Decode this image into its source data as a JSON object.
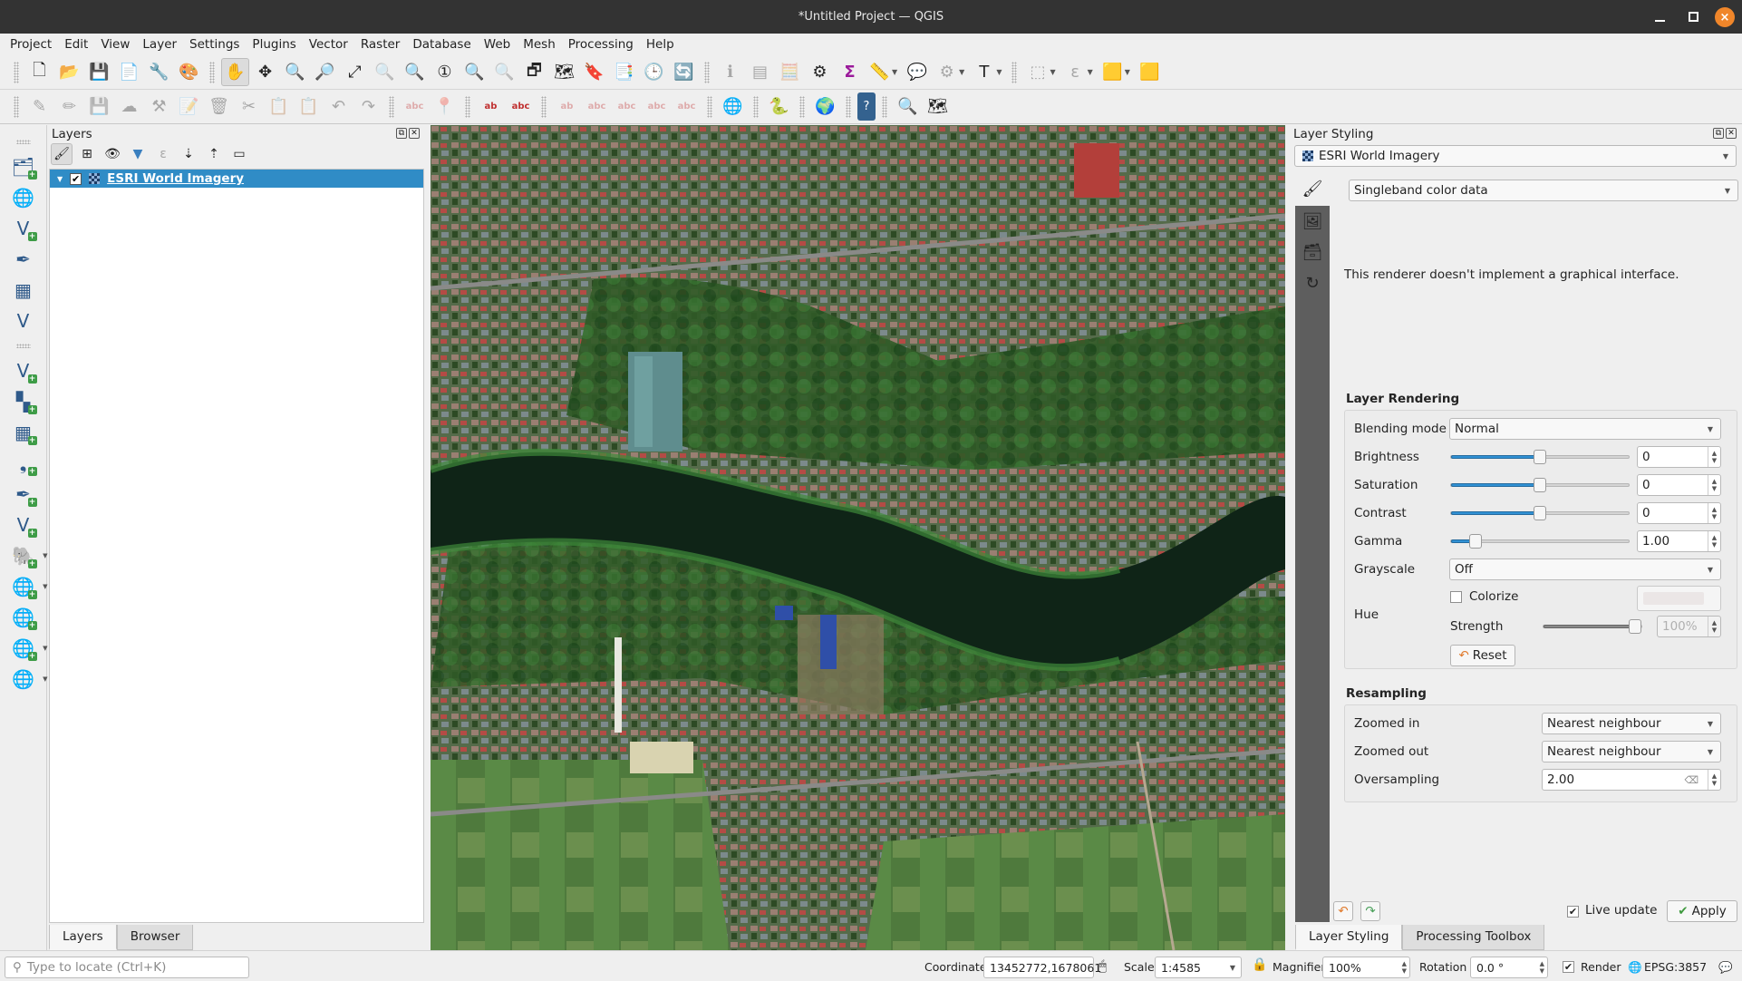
{
  "window": {
    "title": "*Untitled Project — QGIS",
    "controls": {
      "minimize": "minimize",
      "maximize": "maximize",
      "close": "×"
    }
  },
  "menubar": [
    "Project",
    "Edit",
    "View",
    "Layer",
    "Settings",
    "Plugins",
    "Vector",
    "Raster",
    "Database",
    "Web",
    "Mesh",
    "Processing",
    "Help"
  ],
  "toolbar1": [
    {
      "name": "new-project-icon",
      "glyph": "🗋"
    },
    {
      "name": "open-project-icon",
      "glyph": "📂"
    },
    {
      "name": "save-project-icon",
      "glyph": "💾"
    },
    {
      "name": "new-print-layout-icon",
      "glyph": "📄"
    },
    {
      "name": "layout-manager-icon",
      "glyph": "🔧"
    },
    {
      "name": "style-manager-icon",
      "glyph": "🎨"
    },
    {
      "name": "pan-map-icon",
      "glyph": "✋",
      "active": true
    },
    {
      "name": "pan-to-selection-icon",
      "glyph": "✥"
    },
    {
      "name": "zoom-in-icon",
      "glyph": "🔍"
    },
    {
      "name": "zoom-out-icon",
      "glyph": "🔎"
    },
    {
      "name": "zoom-full-icon",
      "glyph": "⤢"
    },
    {
      "name": "zoom-to-selection-icon",
      "glyph": "🔍",
      "dim": true
    },
    {
      "name": "zoom-to-layer-icon",
      "glyph": "🔍"
    },
    {
      "name": "zoom-native-resolution-icon",
      "glyph": "①"
    },
    {
      "name": "zoom-last-icon",
      "glyph": "🔍"
    },
    {
      "name": "zoom-next-icon",
      "glyph": "🔍",
      "dim": true
    },
    {
      "name": "new-map-view-icon",
      "glyph": "🗗"
    },
    {
      "name": "new-3d-map-view-icon",
      "glyph": "🗺"
    },
    {
      "name": "new-bookmark-icon",
      "glyph": "🔖"
    },
    {
      "name": "show-bookmarks-icon",
      "glyph": "📑"
    },
    {
      "name": "temporal-controller-icon",
      "glyph": "🕒"
    },
    {
      "name": "refresh-icon",
      "glyph": "🔄"
    },
    {
      "name": "identify-features-icon",
      "glyph": "ℹ",
      "dim": true
    },
    {
      "name": "attribute-table-icon",
      "glyph": "▤",
      "dim": true
    },
    {
      "name": "field-calculator-icon",
      "glyph": "🧮",
      "dim": true
    },
    {
      "name": "processing-toolbox-icon",
      "glyph": "⚙"
    },
    {
      "name": "statistical-summary-icon",
      "glyph": "Σ"
    },
    {
      "name": "measure-line-icon",
      "glyph": "📏",
      "dropdown": true
    },
    {
      "name": "map-tips-icon",
      "glyph": "💬"
    },
    {
      "name": "actions-icon",
      "glyph": "⚙",
      "dim": true,
      "dropdown": true
    },
    {
      "name": "text-annotation-icon",
      "glyph": "T",
      "dropdown": true
    },
    {
      "name": "select-features-icon",
      "glyph": "⬚",
      "dim": true,
      "dropdown": true
    },
    {
      "name": "select-by-expression-icon",
      "glyph": "ε",
      "dim": true,
      "dropdown": true
    },
    {
      "name": "deselect-all-icon",
      "glyph": "🟨",
      "dropdown": true
    },
    {
      "name": "select-by-location-icon",
      "glyph": "🟨"
    }
  ],
  "toolbar2": [
    {
      "name": "current-edits-icon",
      "glyph": "✎",
      "dim": true
    },
    {
      "name": "toggle-editing-icon",
      "glyph": "✏",
      "dim": true
    },
    {
      "name": "save-edits-icon",
      "glyph": "💾",
      "dim": true
    },
    {
      "name": "digitize-icon",
      "glyph": "☁",
      "dim": true
    },
    {
      "name": "vertex-tool-icon",
      "glyph": "⚒",
      "dim": true
    },
    {
      "name": "modify-attributes-icon",
      "glyph": "📝",
      "dim": true
    },
    {
      "name": "delete-selected-icon",
      "glyph": "🗑",
      "dim": true
    },
    {
      "name": "cut-features-icon",
      "glyph": "✂",
      "dim": true
    },
    {
      "name": "copy-features-icon",
      "glyph": "📋",
      "dim": true
    },
    {
      "name": "paste-features-icon",
      "glyph": "📋",
      "dim": true
    },
    {
      "name": "undo-icon",
      "glyph": "↶",
      "dim": true
    },
    {
      "name": "redo-icon",
      "glyph": "↷",
      "dim": true
    },
    {
      "name": "label-toolbar-icon",
      "glyph": "abc",
      "dim": true
    },
    {
      "name": "label-pin-icon",
      "glyph": "📍",
      "dim": true
    },
    {
      "name": "layer-labeling-options-icon",
      "glyph": "ab"
    },
    {
      "name": "layer-diagram-options-icon",
      "glyph": "abc"
    },
    {
      "name": "highlight-pinned-labels-icon",
      "glyph": "ab",
      "dim": true
    },
    {
      "name": "show-hide-labels-icon",
      "glyph": "abc",
      "dim": true
    },
    {
      "name": "move-label-icon",
      "glyph": "abc",
      "dim": true
    },
    {
      "name": "rotate-label-icon",
      "glyph": "abc",
      "dim": true
    },
    {
      "name": "change-label-icon",
      "glyph": "abc",
      "dim": true
    },
    {
      "name": "metasearch-icon",
      "glyph": "🌐"
    },
    {
      "name": "python-console-icon",
      "glyph": "🐍"
    },
    {
      "name": "geometry-checker-icon",
      "glyph": "🌍"
    },
    {
      "name": "help-icon",
      "glyph": "?"
    },
    {
      "name": "quickmapservices-search-icon",
      "glyph": "🔍"
    },
    {
      "name": "plugin-icon",
      "glyph": "🗺"
    }
  ],
  "left_toolbar": [
    {
      "name": "data-source-manager-icon",
      "glyph": "🗂",
      "plus": true
    },
    {
      "name": "new-geopackage-layer-icon",
      "glyph": "🌐",
      "plus": false
    },
    {
      "name": "new-shapefile-layer-icon",
      "glyph": "V",
      "plus": true
    },
    {
      "name": "new-temporary-scratch-layer-icon",
      "glyph": "✒",
      "plus": false
    },
    {
      "name": "new-virtual-layer-icon",
      "glyph": "▦",
      "plus": false
    },
    {
      "name": "new-spatialite-layer-icon",
      "glyph": "V",
      "plus": false
    },
    {
      "name": "add-vector-layer-icon",
      "glyph": "V",
      "plus": true
    },
    {
      "name": "add-raster-layer-icon",
      "glyph": "▚",
      "plus": true
    },
    {
      "name": "add-mesh-layer-icon",
      "glyph": "▦",
      "plus": true
    },
    {
      "name": "add-delimited-text-layer-icon",
      "glyph": "❟",
      "plus": true
    },
    {
      "name": "add-spatialite-layer-icon",
      "glyph": "✒",
      "plus": true
    },
    {
      "name": "add-virtual-layer-icon",
      "glyph": "V",
      "plus": true
    },
    {
      "name": "add-postgis-layer-icon",
      "glyph": "🐘",
      "plus": true,
      "dropdown": true
    },
    {
      "name": "add-wms-layer-icon",
      "glyph": "🌐",
      "plus": true,
      "dropdown": true
    },
    {
      "name": "add-xyz-layer-icon",
      "glyph": "🌐",
      "plus": true
    },
    {
      "name": "add-wfs-layer-icon",
      "glyph": "🌐",
      "plus": true,
      "dropdown": true
    },
    {
      "name": "add-arcgis-layer-icon",
      "glyph": "🌐",
      "plus": false,
      "dropdown": true
    }
  ],
  "layers_panel": {
    "title": "Layers",
    "tools": [
      "open-styling-panel-icon",
      "add-group-icon",
      "manage-visibility-icon",
      "filter-legend-icon",
      "filter-by-expression-icon",
      "expand-all-icon",
      "collapse-all-icon",
      "remove-layer-icon"
    ],
    "layers": [
      {
        "name": "ESRI World Imagery",
        "checked": true,
        "selected": true
      }
    ],
    "tabs": [
      "Layers",
      "Browser"
    ],
    "active_tab": "Layers"
  },
  "styling_panel": {
    "title": "Layer Styling",
    "layer": "ESRI World Imagery",
    "renderer": "Singleband color data",
    "info": "This renderer doesn't implement a graphical interface.",
    "layer_rendering": {
      "title": "Layer Rendering",
      "blending_mode_label": "Blending mode",
      "blending_mode": "Normal",
      "brightness_label": "Brightness",
      "brightness": "0",
      "brightness_slider": 0.5,
      "saturation_label": "Saturation",
      "saturation": "0",
      "saturation_slider": 0.5,
      "contrast_label": "Contrast",
      "contrast": "0",
      "contrast_slider": 0.5,
      "gamma_label": "Gamma",
      "gamma": "1.00",
      "gamma_slider": 0.11,
      "grayscale_label": "Grayscale",
      "grayscale": "Off",
      "hue_label": "Hue",
      "colorize_label": "Colorize",
      "colorize": false,
      "strength_label": "Strength",
      "strength": "100%",
      "strength_slider": 1.0,
      "reset_label": "Reset"
    },
    "resampling": {
      "title": "Resampling",
      "zoomed_in_label": "Zoomed in",
      "zoomed_in": "Nearest neighbour",
      "zoomed_out_label": "Zoomed out",
      "zoomed_out": "Nearest neighbour",
      "oversampling_label": "Oversampling",
      "oversampling": "2.00"
    },
    "live_update_label": "Live update",
    "live_update": true,
    "apply_label": "Apply",
    "tabs": [
      "Layer Styling",
      "Processing Toolbox"
    ],
    "active_tab": "Layer Styling"
  },
  "statusbar": {
    "locator_placeholder": "Type to locate (Ctrl+K)",
    "coordinate_label": "Coordinate",
    "coordinate": "13452772,1678061",
    "scale_label": "Scale",
    "scale": "1:4585",
    "magnifier_label": "Magnifier",
    "magnifier": "100%",
    "rotation_label": "Rotation",
    "rotation": "0.0 °",
    "render_label": "Render",
    "render": true,
    "crs": "EPSG:3857"
  },
  "colors": {
    "selection": "#308cc6",
    "slider_fill": "#3191d4",
    "titlebar": "#333333",
    "close_button": "#f0862a",
    "river": "#0f2417"
  }
}
